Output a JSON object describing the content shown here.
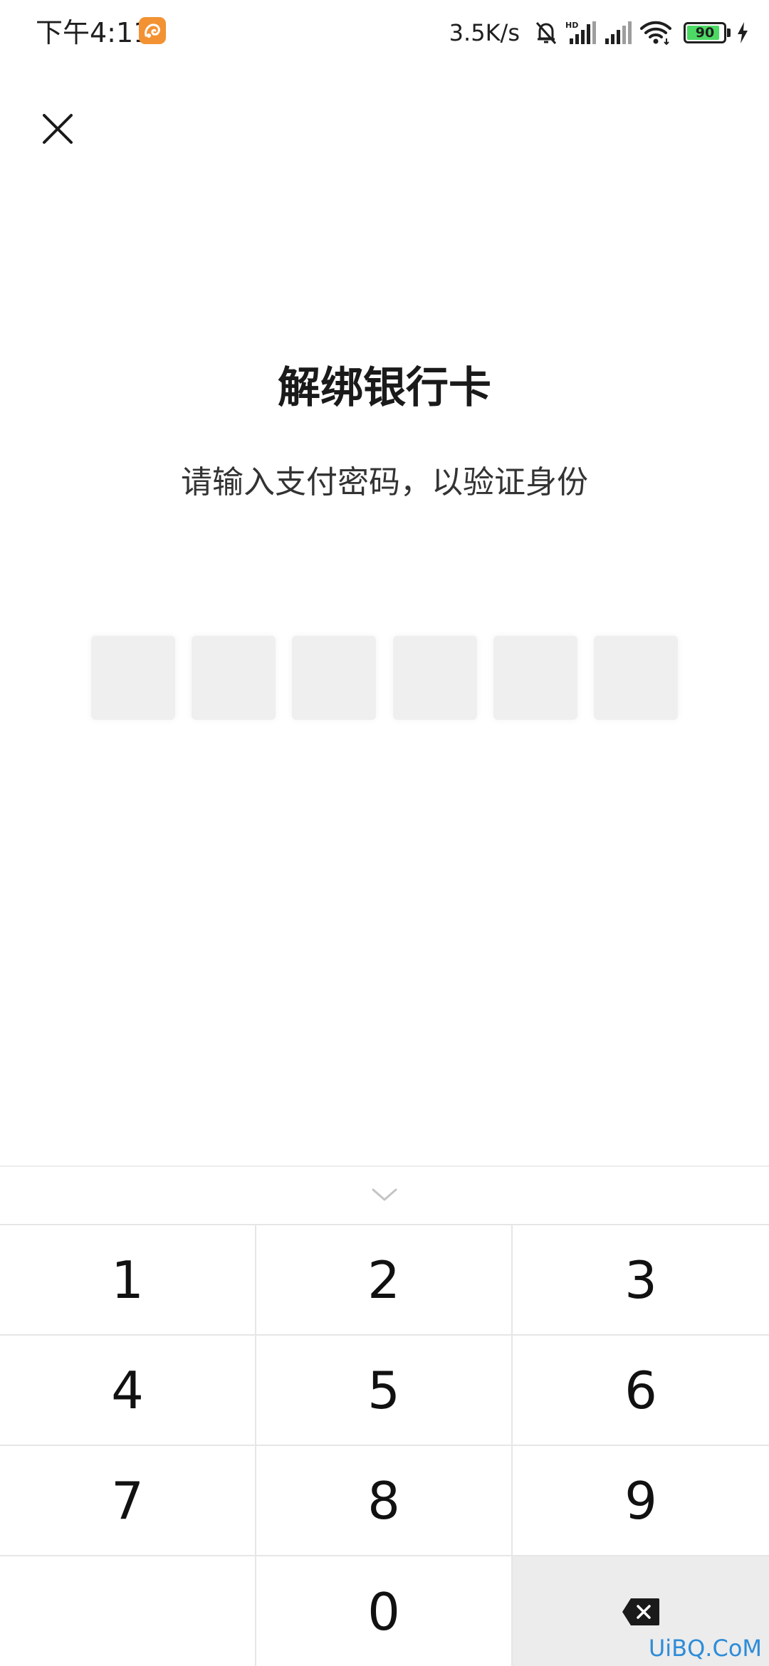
{
  "status_bar": {
    "time": "下午4:11",
    "app_icon": "uc-browser-icon",
    "net_speed": "3.5K/s",
    "icons": [
      "mute-bell-icon",
      "hd-signal-icon",
      "signal-icon",
      "wifi-icon"
    ],
    "battery_level": 90,
    "battery_label": "90",
    "charging_icon": "lightning-icon",
    "battery_color": "#4cd964"
  },
  "header": {
    "close_icon": "close-icon"
  },
  "main": {
    "title": "解绑银行卡",
    "subtitle": "请输入支付密码，以验证身份",
    "pin_length": 6,
    "pin_filled": 0
  },
  "keyboard": {
    "collapse_icon": "chevron-down-icon",
    "keys": [
      [
        "1",
        "2",
        "3"
      ],
      [
        "4",
        "5",
        "6"
      ],
      [
        "7",
        "8",
        "9"
      ],
      [
        "",
        "0",
        "delete"
      ]
    ],
    "delete_icon": "backspace-icon"
  },
  "watermark": "UiBQ.CoM"
}
